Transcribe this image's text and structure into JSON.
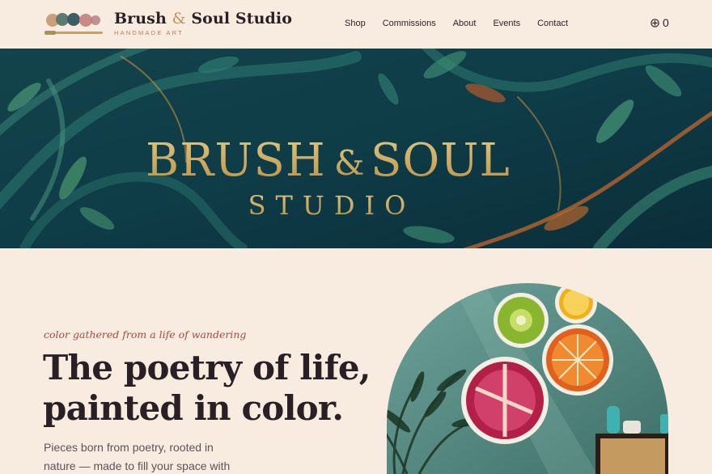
{
  "brand": {
    "name_part1": "Brush",
    "ampersand": "&",
    "name_part2": "Soul Studio",
    "tagline": "HANDMADE ART"
  },
  "nav": {
    "items": [
      {
        "label": "Shop"
      },
      {
        "label": "Commissions"
      },
      {
        "label": "About"
      },
      {
        "label": "Events"
      },
      {
        "label": "Contact"
      }
    ]
  },
  "cart": {
    "icon": "cart-icon",
    "count": "0"
  },
  "banner": {
    "line1_part1": "BRUSH",
    "line1_amp": "&",
    "line1_part2": "SOUL",
    "line2": "STUDIO"
  },
  "hero": {
    "eyebrow": "color gathered from a life of wandering",
    "headline": "The poetry of life, painted in color.",
    "body": "Pieces born from poetry, rooted in nature — made to fill your space with"
  },
  "colors": {
    "background": "#f8ece0",
    "text": "#2a1f24",
    "accent": "#a14b3c",
    "banner_teal": "#0f4a52",
    "gold": "#d0b068"
  }
}
